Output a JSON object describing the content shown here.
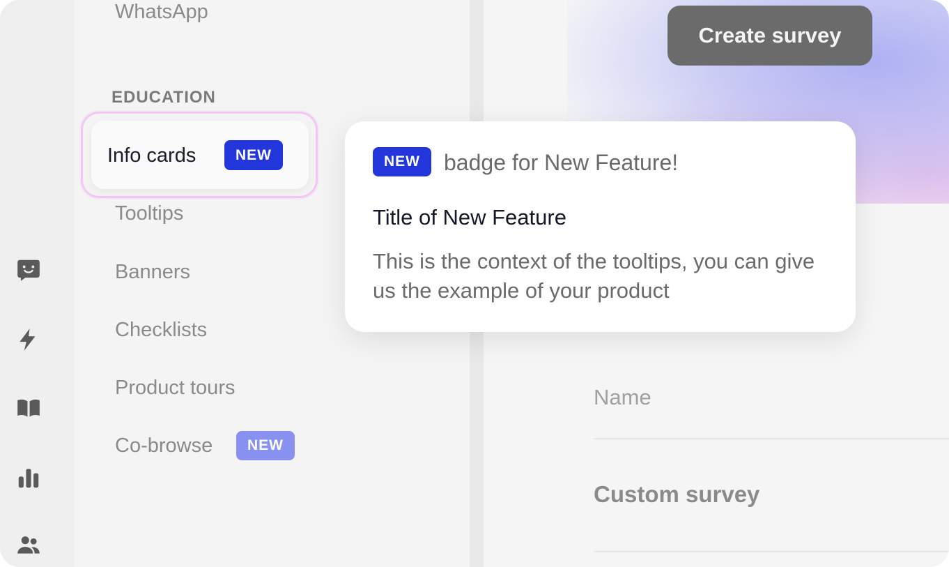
{
  "rail": {
    "icons": [
      "chat-smile-icon",
      "lightning-icon",
      "book-icon",
      "bar-chart-icon",
      "users-icon"
    ]
  },
  "sidebar": {
    "item_whatsapp": "WhatsApp",
    "section_education": "EDUCATION",
    "active_item": {
      "label": "Info cards",
      "badge": "NEW"
    },
    "items": [
      {
        "label": "Tooltips"
      },
      {
        "label": "Banners"
      },
      {
        "label": "Checklists"
      },
      {
        "label": "Product tours"
      },
      {
        "label": "Co-browse",
        "badge": "NEW"
      }
    ]
  },
  "main": {
    "create_button": "Create survey",
    "column_name": "Name",
    "row_custom_survey": "Custom survey"
  },
  "tooltip": {
    "badge": "NEW",
    "badge_caption": "badge for New Feature!",
    "title": "Title of New Feature",
    "body": "This is the context of the tooltips, you can give us the example of your product"
  },
  "colors": {
    "badge_strong": "#2336db",
    "badge_soft": "#8891f0",
    "active_outline": "#f3c6f6",
    "button_bg": "#6b6b6b"
  }
}
